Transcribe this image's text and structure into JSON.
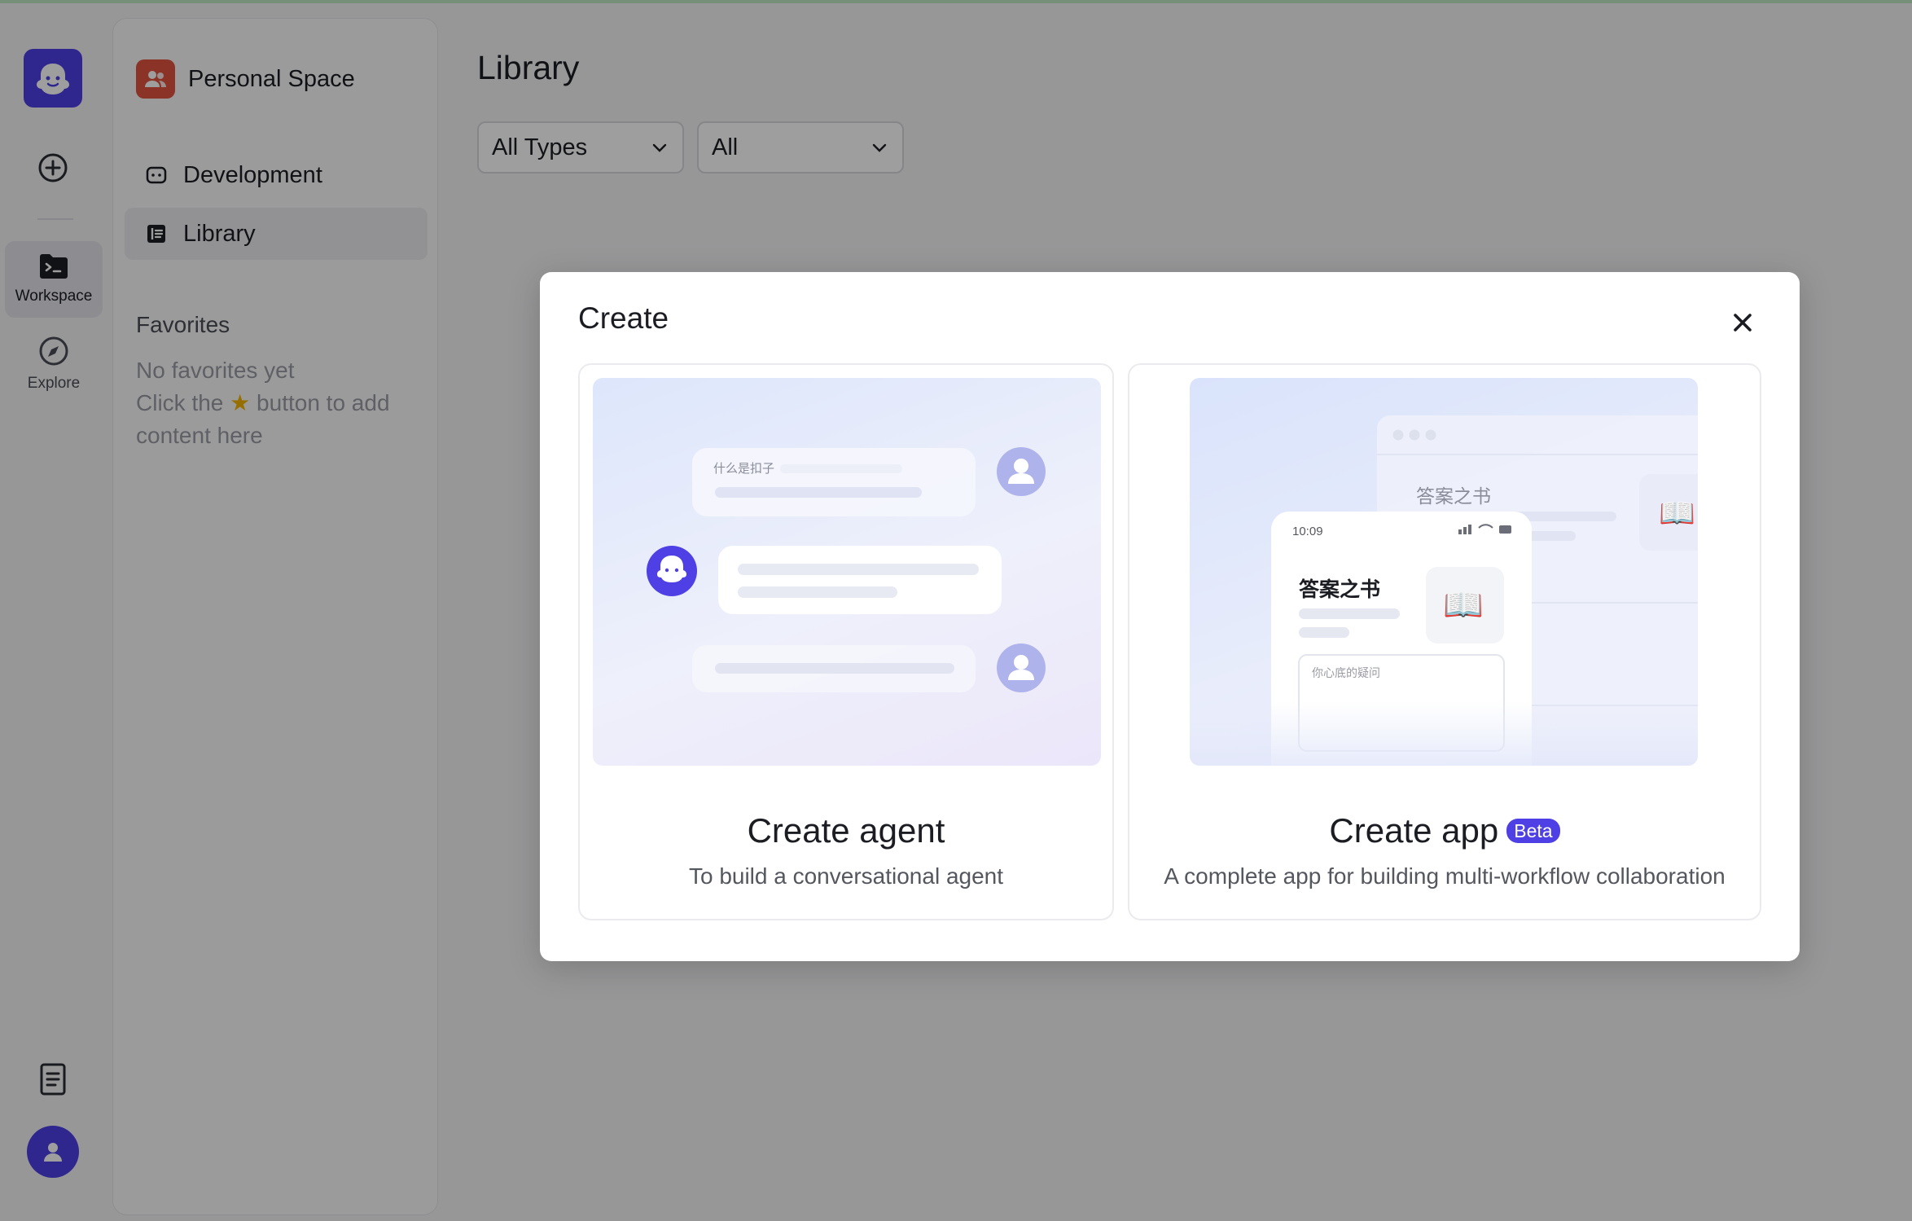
{
  "rail": {
    "items": [
      {
        "label": "Workspace"
      },
      {
        "label": "Explore"
      }
    ]
  },
  "sidebar": {
    "space_name": "Personal Space",
    "items": [
      {
        "label": "Development"
      },
      {
        "label": "Library"
      }
    ],
    "favorites_title": "Favorites",
    "favorites_empty_line1": "No favorites yet",
    "favorites_empty_line2_pre": "Click the",
    "favorites_empty_line2_post": "button to add content here"
  },
  "main": {
    "title": "Library",
    "filters": [
      {
        "value": "All Types"
      },
      {
        "value": "All"
      }
    ]
  },
  "modal": {
    "title": "Create",
    "cards": [
      {
        "title": "Create agent",
        "description": "To build a conversational agent",
        "illustration": {
          "question": "什么是扣子"
        }
      },
      {
        "title": "Create app",
        "badge": "Beta",
        "description": "A complete app for building multi-workflow collaboration",
        "illustration": {
          "back_title": "答案之书",
          "phone_time": "10:09",
          "phone_title": "答案之书",
          "phone_input": "你心底的疑问"
        }
      }
    ]
  },
  "colors": {
    "brand": "#4e40e5",
    "space_icon": "#e0533e",
    "overlay": "rgba(0,0,0,0.38)"
  }
}
